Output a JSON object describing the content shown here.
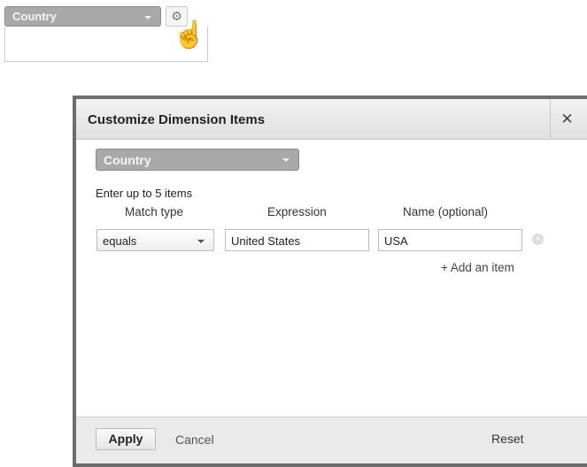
{
  "background": {
    "dimension_select": "Country",
    "settings_icon": "gear-icon",
    "cursor_icon": "hand-pointer-icon"
  },
  "dialog": {
    "title": "Customize Dimension Items",
    "close_icon": "close-icon",
    "dimension_select": "Country",
    "hint": "Enter up to 5 items",
    "columns": [
      "Match type",
      "Expression",
      "Name (optional)"
    ],
    "items": [
      {
        "match_type": "equals",
        "expression": "United States",
        "name": "USA"
      }
    ],
    "add_item": "+ Add an item",
    "footer": {
      "apply": "Apply",
      "cancel": "Cancel",
      "reset": "Reset"
    }
  }
}
